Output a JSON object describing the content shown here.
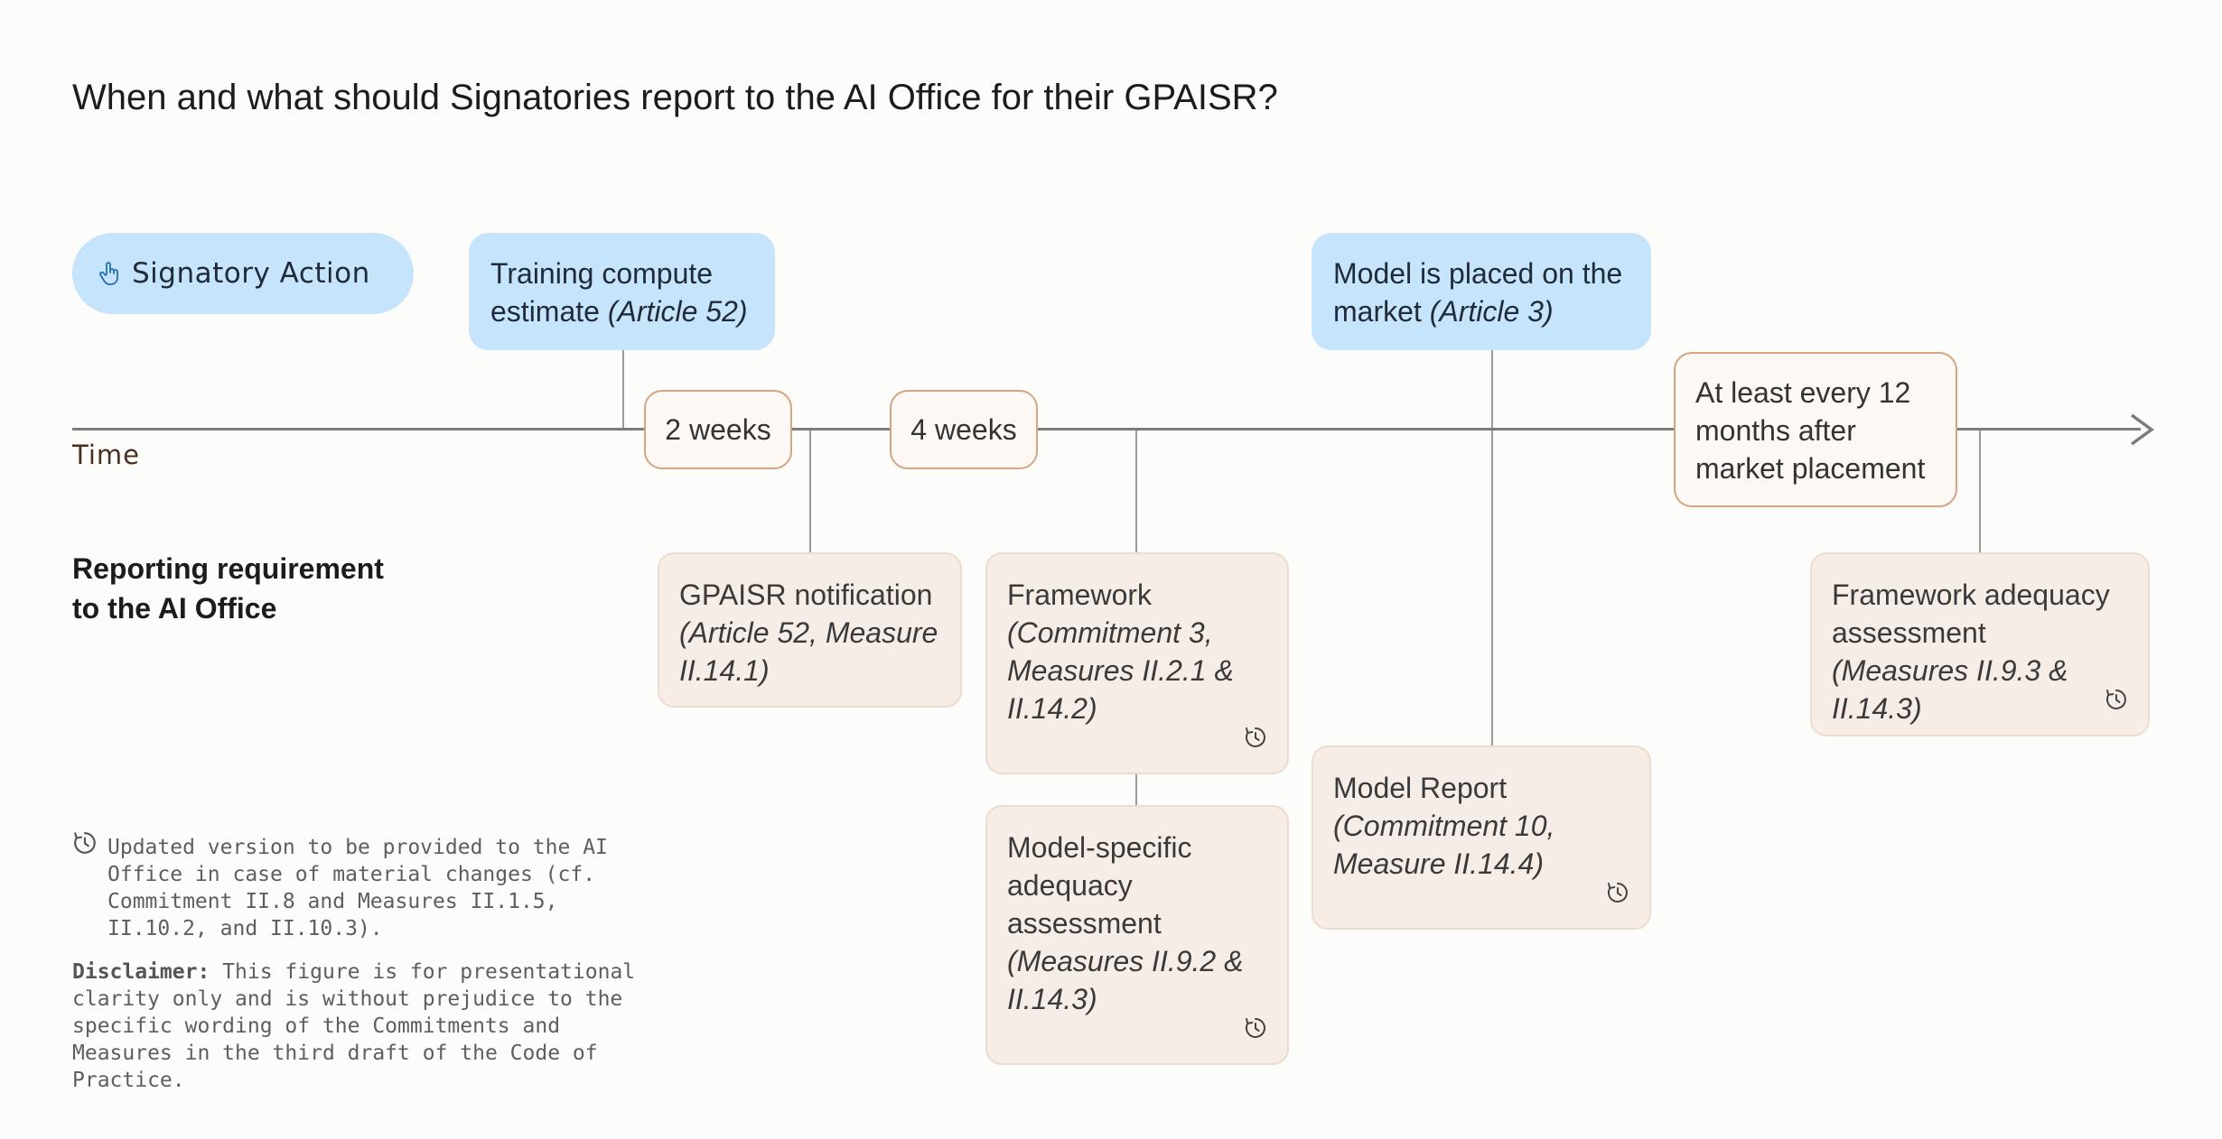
{
  "title": "When and what should Signatories report to the AI Office for their GPAISR?",
  "legend_key": {
    "label": "Signatory Action",
    "icon": "hand-pointer-icon"
  },
  "timeline": {
    "axis_label": "Time",
    "events": [
      {
        "text": "Training compute estimate ",
        "reference": "(Article 52)"
      },
      {
        "text": "Model is placed on the market ",
        "reference": "(Article 3)"
      }
    ],
    "durations": [
      "2 weeks",
      "4 weeks",
      "At least every 12 months after market placement"
    ]
  },
  "reporting": {
    "heading": "Reporting requirement to the AI Office",
    "items": [
      {
        "text": "GPAISR notification ",
        "reference": "(Article 52, Measure II.14.1)",
        "recurring": false
      },
      {
        "text": "Framework ",
        "reference": "(Commitment 3, Measures II.2.1 & II.14.2)",
        "recurring": true
      },
      {
        "text": "Model-specific adequacy assessment ",
        "reference": "(Measures II.9.2 & II.14.3)",
        "recurring": true
      },
      {
        "text": "Model Report ",
        "reference": "(Commitment 10, Measure II.14.4)",
        "recurring": true
      },
      {
        "text": "Framework adequacy assessment ",
        "reference": "(Measures II.9.3 & II.14.3)",
        "recurring": true
      }
    ]
  },
  "legend_note": {
    "icon": "refresh-icon",
    "text": "Updated version to be provided to the AI Office in case of material changes (cf. Commitment II.8 and Measures II.1.5, II.10.2, and II.10.3)."
  },
  "disclaimer": {
    "label": "Disclaimer:",
    "text": " This figure is for presentational clarity only and is without prejudice to the specific wording of the Commitments and Measures in the third draft of the Code of Practice."
  },
  "colors": {
    "event_fill": "#c6e4fb",
    "requirement_fill": "#f6ede7",
    "duration_border": "#d4a582",
    "axis": "#7c7c7c"
  }
}
